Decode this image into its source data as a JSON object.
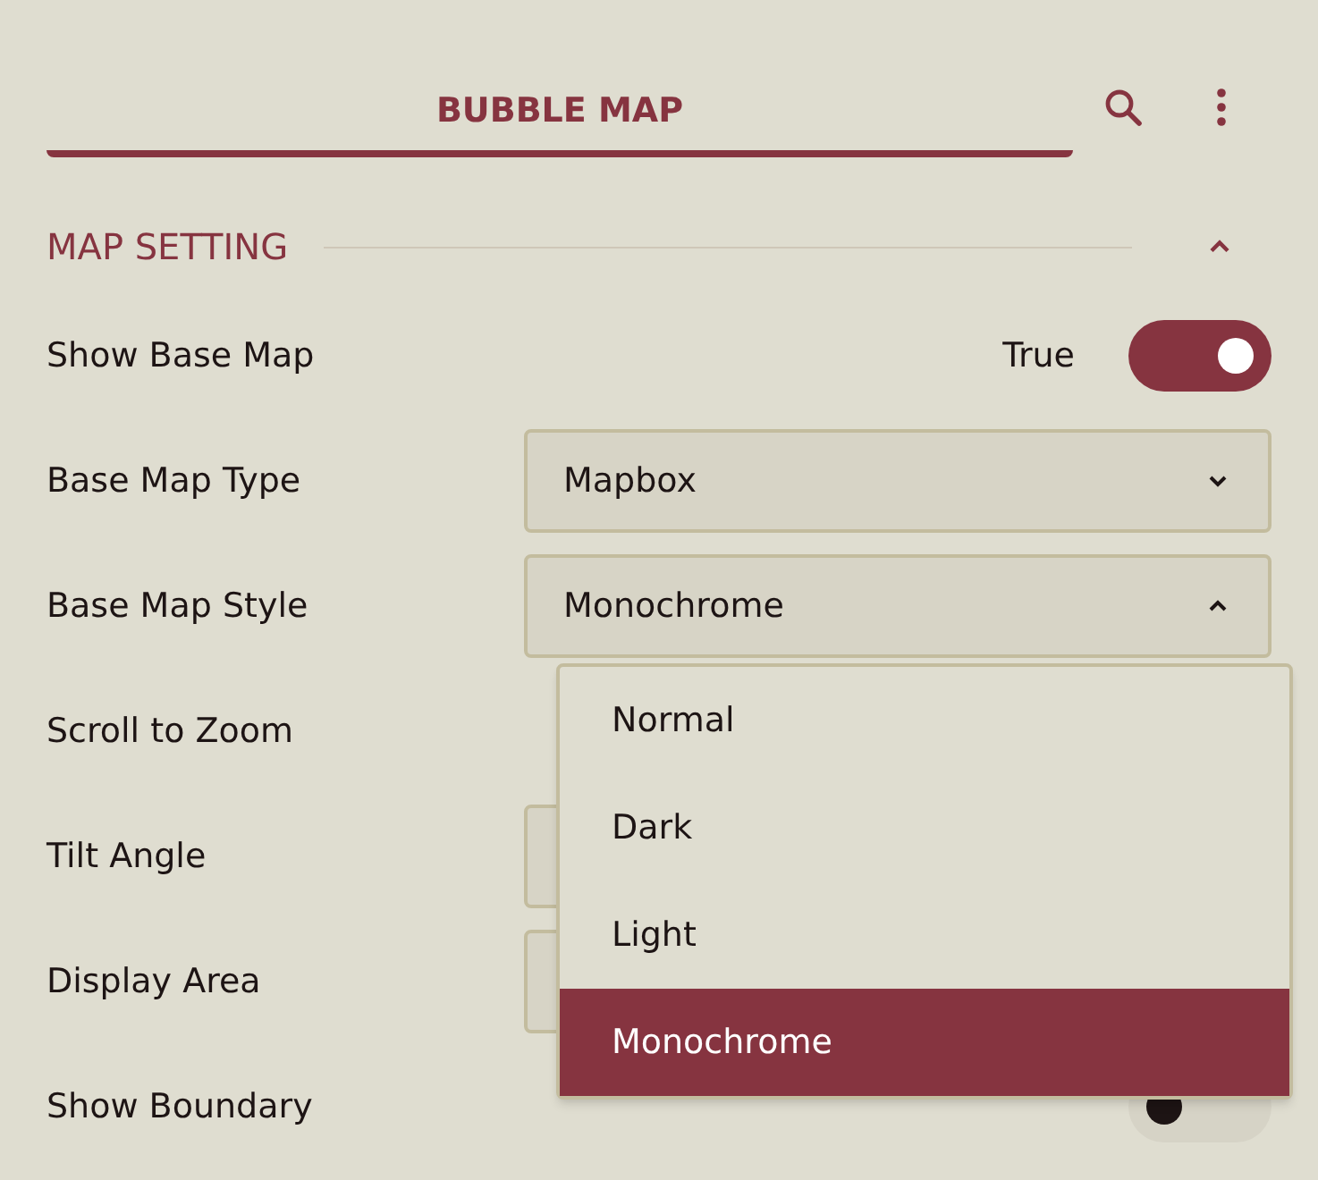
{
  "header": {
    "tab": {
      "label": "BUBBLE MAP",
      "selected": true
    }
  },
  "section": {
    "title": "MAP SETTING",
    "expanded": true,
    "rows": [
      {
        "kind": "toggle",
        "label": "Show Base Map",
        "value": "True",
        "on": true
      },
      {
        "kind": "select",
        "label": "Base Map Type",
        "value": "Mapbox",
        "expanded": false
      },
      {
        "kind": "select",
        "label": "Base Map Style",
        "value": "Monochrome",
        "expanded": true,
        "options": [
          {
            "label": "Normal",
            "selected": false
          },
          {
            "label": "Dark",
            "selected": false
          },
          {
            "label": "Light",
            "selected": false
          },
          {
            "label": "Monochrome",
            "selected": true
          }
        ]
      },
      {
        "kind": "plain",
        "label": "Scroll to Zoom"
      },
      {
        "kind": "field",
        "label": "Tilt Angle"
      },
      {
        "kind": "field",
        "label": "Display Area"
      },
      {
        "kind": "toggle",
        "label": "Show Boundary",
        "on": false
      }
    ]
  }
}
